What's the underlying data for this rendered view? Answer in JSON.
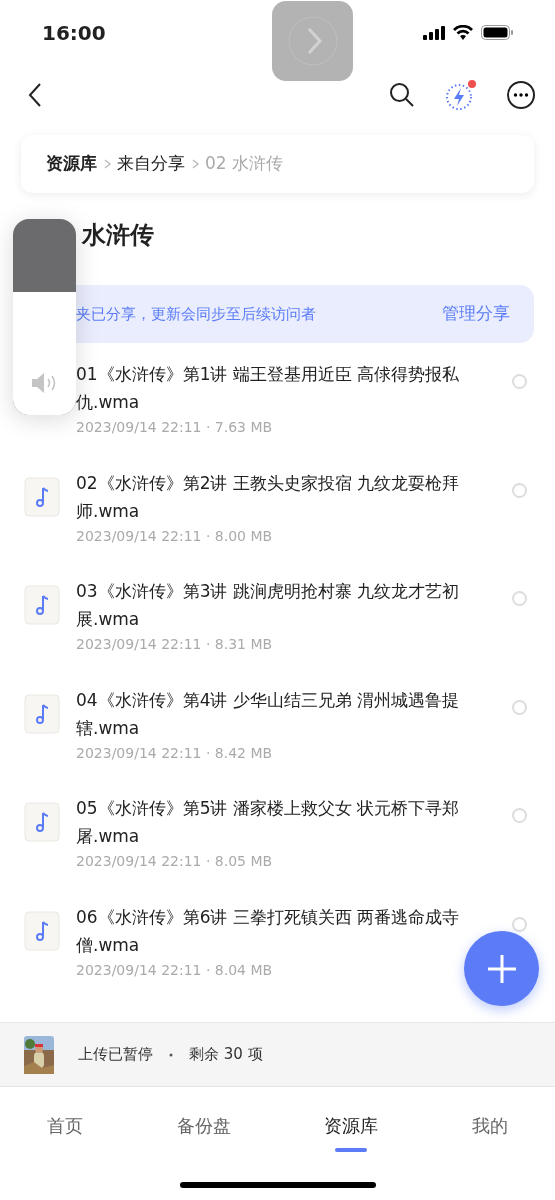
{
  "status_bar": {
    "time": "16:00"
  },
  "breadcrumb": [
    {
      "label": "资源库",
      "current": false
    },
    {
      "label": "来自分享",
      "current": false
    },
    {
      "label": "02 水浒传",
      "current": true
    }
  ],
  "title": "水浒传",
  "share_banner": {
    "text": "夹已分享，更新会同步至后续访问者",
    "action": "管理分享"
  },
  "files": [
    {
      "name": "01《水浒传》第1讲 端王登基用近臣 高俅得势报私仇.wma",
      "meta": "2023/09/14 22:11 · 7.63 MB",
      "selected": false
    },
    {
      "name": "02《水浒传》第2讲 王教头史家投宿 九纹龙耍枪拜师.wma",
      "meta": "2023/09/14 22:11 · 8.00 MB",
      "selected": false
    },
    {
      "name": "03《水浒传》第3讲 跳涧虎明抢村寨 九纹龙才艺初展.wma",
      "meta": "2023/09/14 22:11 · 8.31 MB",
      "selected": false
    },
    {
      "name": "04《水浒传》第4讲 少华山结三兄弟 渭州城遇鲁提辖.wma",
      "meta": "2023/09/14 22:11 · 8.42 MB",
      "selected": false
    },
    {
      "name": "05《水浒传》第5讲 潘家楼上救父女 状元桥下寻郑屠.wma",
      "meta": "2023/09/14 22:11 · 8.05 MB",
      "selected": false
    },
    {
      "name": "06《水浒传》第6讲 三拳打死镇关西 两番逃命成寺僧.wma",
      "meta": "2023/09/14 22:11 · 8.04 MB",
      "selected": false
    }
  ],
  "upload_bar": {
    "status": "上传已暂停",
    "remaining": "剩余 30 项"
  },
  "tabs": [
    {
      "label": "首页",
      "selected": false
    },
    {
      "label": "备份盘",
      "selected": false
    },
    {
      "label": "资源库",
      "selected": true
    },
    {
      "label": "我的",
      "selected": false
    }
  ],
  "volume_hud": {
    "level": 0.63
  }
}
